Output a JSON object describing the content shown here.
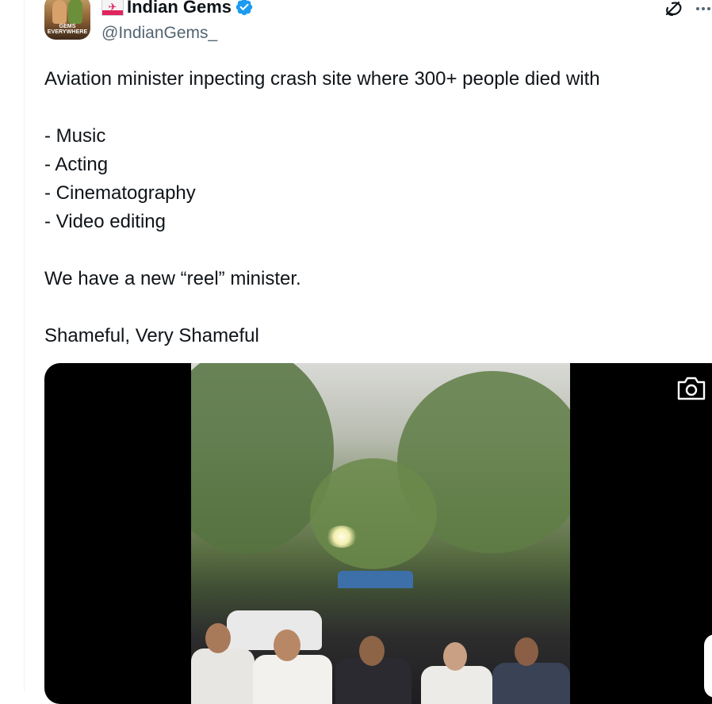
{
  "author": {
    "flag_symbol": "✈",
    "avatar_text": "GEMS EVERYWHERE",
    "display_name": "Indian Gems",
    "handle": "@IndianGems_"
  },
  "tweet": {
    "lines": [
      "Aviation minister inpecting crash site where 300+ people died with",
      "",
      "- Music",
      "- Acting",
      "- Cinematography",
      "- Video editing",
      "",
      "We have a new “reel” minister.",
      "",
      "Shameful, Very Shameful"
    ]
  },
  "icons": {
    "verified": "verified-badge-icon",
    "grok": "grok-icon",
    "more": "more-options-icon",
    "camera": "camera-icon"
  },
  "colors": {
    "verified_blue": "#1d9bf0",
    "text_primary": "#0f1419",
    "text_secondary": "#536471",
    "media_background": "#000000"
  }
}
